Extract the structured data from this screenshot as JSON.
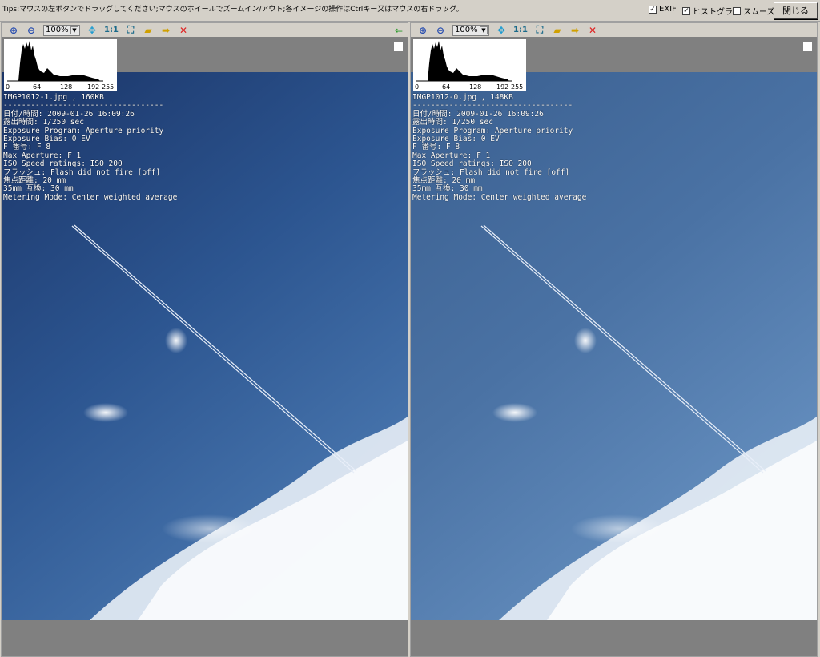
{
  "topbar": {
    "tips": "Tips:マウスの左ボタンでドラッグしてください;マウスのホイールでズームイン/アウト;各イメージの操作はCtrlキー又はマウスの右ドラッグ。",
    "exif_label": "EXIF",
    "exif_checked": true,
    "hist_label": "ヒストグラ",
    "hist_checked": true,
    "smooth_label": "スムーズ",
    "smooth_checked": false,
    "close_label": "閉じる"
  },
  "panels": [
    {
      "zoom": "100%",
      "one_to_one": "1:1",
      "hist_ticks": [
        "0",
        "64",
        "128",
        "192",
        "255"
      ],
      "file": "IMGP1012-1.jpg , 160KB",
      "sep": "-----------------------------------",
      "exif": [
        "日付/時間: 2009-01-26 16:09:26",
        "露出時間: 1/250 sec",
        "Exposure Program: Aperture priority",
        "Exposure Bias: 0 EV",
        "F 番号: F 8",
        "Max Aperture: F 1",
        "ISO Speed ratings: ISO 200",
        "フラッシュ: Flash did not fire [off]",
        "焦点距離: 20 mm",
        "35mm 互換: 30 mm",
        "Metering Mode: Center weighted average"
      ]
    },
    {
      "zoom": "100%",
      "one_to_one": "1:1",
      "hist_ticks": [
        "0",
        "64",
        "128",
        "192",
        "255"
      ],
      "file": "IMGP1012-0.jpg , 148KB",
      "sep": "-----------------------------------",
      "exif": [
        "日付/時間: 2009-01-26 16:09:26",
        "露出時間: 1/250 sec",
        "Exposure Program: Aperture priority",
        "Exposure Bias: 0 EV",
        "F 番号: F 8",
        "Max Aperture: F 1",
        "ISO Speed ratings: ISO 200",
        "フラッシュ: Flash did not fire [off]",
        "焦点距離: 20 mm",
        "35mm 互換: 30 mm",
        "Metering Mode: Center weighted average"
      ]
    }
  ],
  "colors": {
    "sky_dark": "#1d3a72",
    "sky_light": "#3e6aa0",
    "accent_green": "#2a9a2a",
    "delete_red": "#e02020"
  }
}
